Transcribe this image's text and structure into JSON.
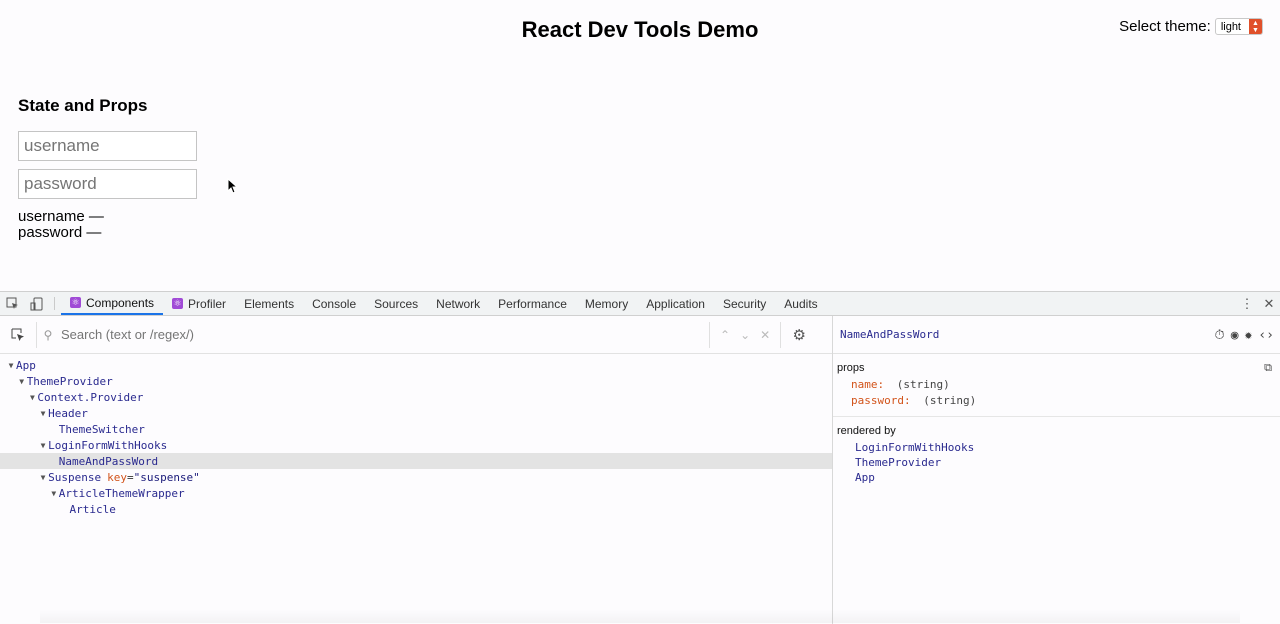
{
  "app": {
    "title": "React Dev Tools Demo",
    "theme_label": "Select theme:",
    "theme_value": "light",
    "section_title": "State and Props",
    "username_placeholder": "username",
    "password_placeholder": "password",
    "username_readout": "username —",
    "password_readout": "password —"
  },
  "devtools": {
    "tabs": [
      {
        "label": "Components",
        "react": true,
        "active": true
      },
      {
        "label": "Profiler",
        "react": true,
        "active": false
      },
      {
        "label": "Elements"
      },
      {
        "label": "Console"
      },
      {
        "label": "Sources"
      },
      {
        "label": "Network"
      },
      {
        "label": "Performance"
      },
      {
        "label": "Memory"
      },
      {
        "label": "Application"
      },
      {
        "label": "Security"
      },
      {
        "label": "Audits"
      }
    ],
    "search_placeholder": "Search (text or /regex/)",
    "tree": [
      {
        "label": "App",
        "depth": 0,
        "expanded": true
      },
      {
        "label": "ThemeProvider",
        "depth": 1,
        "expanded": true
      },
      {
        "label": "Context.Provider",
        "depth": 2,
        "expanded": true
      },
      {
        "label": "Header",
        "depth": 3,
        "expanded": true
      },
      {
        "label": "ThemeSwitcher",
        "depth": 4,
        "expanded": false
      },
      {
        "label": "LoginFormWithHooks",
        "depth": 3,
        "expanded": true
      },
      {
        "label": "NameAndPassWord",
        "depth": 4,
        "expanded": false,
        "selected": true
      },
      {
        "label": "Suspense",
        "depth": 3,
        "expanded": true,
        "prop_key": "key",
        "prop_val": "\"suspense\""
      },
      {
        "label": "ArticleThemeWrapper",
        "depth": 4,
        "expanded": true
      },
      {
        "label": "Article",
        "depth": 5,
        "expanded": false
      }
    ],
    "selected_component": "NameAndPassWord",
    "props_title": "props",
    "props": [
      {
        "name": "name:",
        "type": "(string)"
      },
      {
        "name": "password:",
        "type": "(string)"
      }
    ],
    "rendered_by_title": "rendered by",
    "rendered_by": [
      "LoginFormWithHooks",
      "ThemeProvider",
      "App"
    ]
  }
}
